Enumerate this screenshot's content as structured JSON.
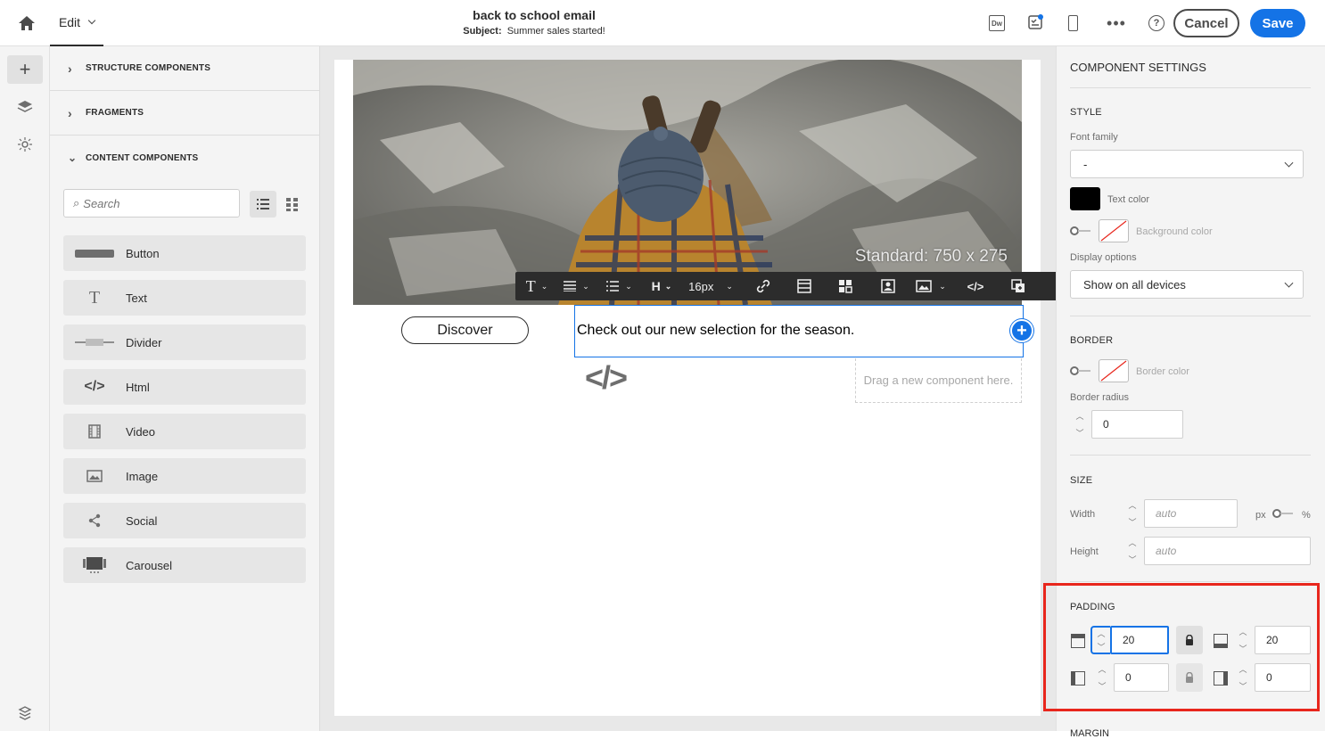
{
  "header": {
    "mode_label": "Edit",
    "email_title": "back to school email",
    "subject_label": "Subject:",
    "subject_value": "Summer sales started!",
    "cancel_label": "Cancel",
    "save_label": "Save",
    "accent_color": "#1473e6"
  },
  "left_panel": {
    "sections": [
      {
        "label": "STRUCTURE COMPONENTS"
      },
      {
        "label": "FRAGMENTS"
      },
      {
        "label": "CONTENT COMPONENTS"
      }
    ],
    "search_placeholder": "Search",
    "components": [
      {
        "label": "Button",
        "icon": "button-icon"
      },
      {
        "label": "Text",
        "icon": "text-icon"
      },
      {
        "label": "Divider",
        "icon": "divider-icon"
      },
      {
        "label": "Html",
        "icon": "code-icon"
      },
      {
        "label": "Video",
        "icon": "film-icon"
      },
      {
        "label": "Image",
        "icon": "image-icon"
      },
      {
        "label": "Social",
        "icon": "share-icon"
      },
      {
        "label": "Carousel",
        "icon": "carousel-icon"
      }
    ]
  },
  "canvas": {
    "image_overlay_text": "Standard: 750 x 275",
    "button_label": "Discover",
    "text_content": "Check out our new selection for the season.",
    "drop_hint": "Drag a new component here.",
    "toolbar": {
      "font_size": "16px"
    }
  },
  "right_panel": {
    "title": "COMPONENT SETTINGS",
    "style": {
      "heading": "STYLE",
      "font_family_label": "Font family",
      "font_family_value": "-",
      "text_color_label": "Text color",
      "text_color": "#000000",
      "background_color_label": "Background color",
      "display_options_label": "Display options",
      "display_options_value": "Show on all devices"
    },
    "border": {
      "heading": "BORDER",
      "border_color_label": "Border color",
      "border_radius_label": "Border radius",
      "border_radius_value": "0"
    },
    "size": {
      "heading": "SIZE",
      "width_label": "Width",
      "width_placeholder": "auto",
      "height_label": "Height",
      "height_placeholder": "auto",
      "unit_px": "px",
      "unit_pct": "%"
    },
    "padding": {
      "heading": "PADDING",
      "top": "20",
      "bottom": "20",
      "left": "0",
      "right": "0",
      "highlight_color": "#e8261c"
    },
    "next_heading": "MARGIN"
  }
}
